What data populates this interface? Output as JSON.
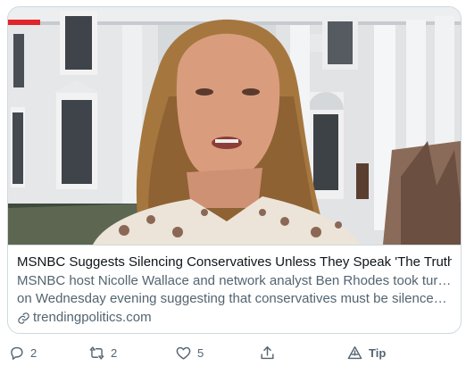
{
  "card": {
    "title": "MSNBC Suggests Silencing Conservatives Unless They Speak 'The Truth'",
    "description_line1": "MSNBC host Nicolle Wallace and network analyst Ben Rhodes took turns",
    "description_line2": "on Wednesday evening suggesting that conservatives must be silenced ...",
    "domain": "trendingpolitics.com"
  },
  "actions": {
    "reply_count": "2",
    "retweet_count": "2",
    "like_count": "5",
    "tip_label": "Tip"
  },
  "icons": {
    "reply": "reply-icon",
    "retweet": "retweet-icon",
    "like": "heart-icon",
    "share": "share-icon",
    "tip": "tip-icon",
    "link": "link-icon"
  },
  "colors": {
    "text_primary": "#0f1419",
    "text_secondary": "#536471",
    "border": "#cfd9de",
    "live_bar": "#e0252b"
  }
}
